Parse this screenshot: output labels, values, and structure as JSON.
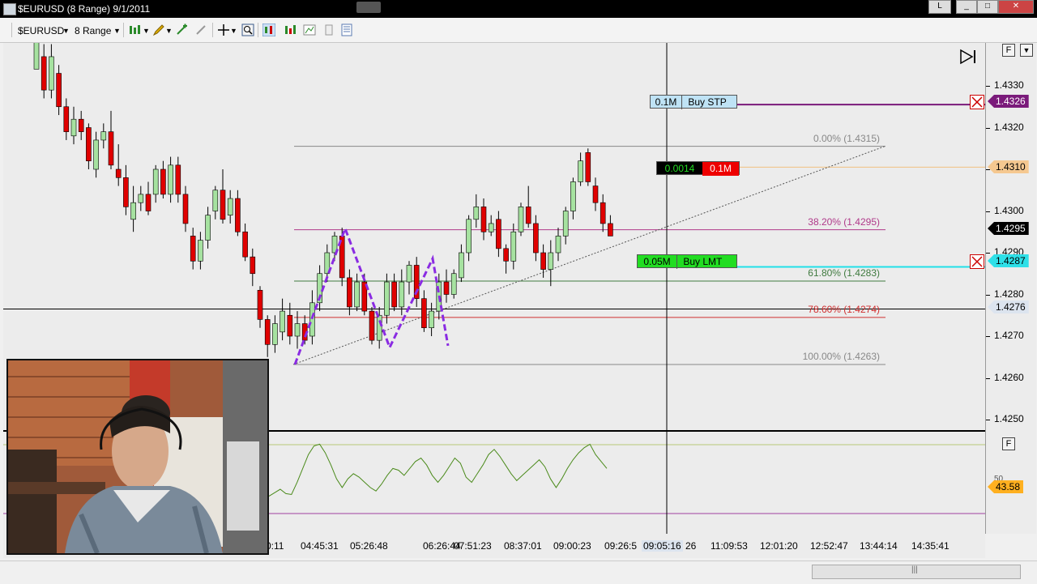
{
  "window": {
    "title": "$EURUSD (8 Range)  9/1/2011",
    "minimize": "_",
    "maximize": "□",
    "close": "✕",
    "extra_btn": "L"
  },
  "toolbar": {
    "instrument": "$EURUSD",
    "period": "8 Range"
  },
  "price_axis": {
    "ticks": [
      "1.4330",
      "1.4320",
      "1.4310",
      "1.4300",
      "1.4290",
      "1.4280",
      "1.4270",
      "1.4260",
      "1.4250"
    ],
    "labels": {
      "buy_stop": "1.4326",
      "position": "1.4310",
      "last": "1.4295",
      "buy_limit": "1.4287",
      "crosshair": "1.4276",
      "indicator": "43.58"
    },
    "indicator_tick": "50"
  },
  "orders": {
    "buy_stop": {
      "qty": "0.1M",
      "label": "Buy STP"
    },
    "position": {
      "pnl": "0.0014",
      "qty": "0.1M"
    },
    "buy_limit": {
      "qty": "0.05M",
      "label": "Buy LMT"
    }
  },
  "fib_levels": [
    {
      "label": "0.00% (1.4315)",
      "price": 1.43155,
      "color": "#888888"
    },
    {
      "label": "38.20% (1.4295)",
      "price": 1.42955,
      "color": "#b03a8a"
    },
    {
      "label": "61.80% (1.4283)",
      "price": 1.42832,
      "color": "#3f7a3f"
    },
    {
      "label": "78.60% (1.4274)",
      "price": 1.42745,
      "color": "#d03030"
    },
    {
      "label": "100.00% (1.4263)",
      "price": 1.42632,
      "color": "#888888"
    }
  ],
  "panel_buttons": {
    "f_top": "F",
    "f_bottom": "F",
    "dropdown": "▼"
  },
  "time_axis": {
    "labels": [
      "0:11",
      "04:45:31",
      "05:26:48",
      "06:26:44",
      "07:51:23",
      "08:37:01",
      "09:00:23",
      "09:26:5",
      "09:05:16",
      "26",
      "11:09:53",
      "12:01:20",
      "12:52:47",
      "13:44:14",
      "14:35:41"
    ],
    "left_stub": "2"
  },
  "chart_data": {
    "type": "candlestick",
    "instrument": "$EURUSD",
    "bar_type": "8 Range",
    "date": "9/1/2011",
    "ylim": [
      1.4245,
      1.434
    ],
    "candles": [
      {
        "o": 1.4334,
        "c": 1.4343,
        "h": 1.4348,
        "l": 1.4334
      },
      {
        "o": 1.4337,
        "c": 1.4329,
        "h": 1.434,
        "l": 1.4327
      },
      {
        "o": 1.4329,
        "c": 1.4337,
        "h": 1.434,
        "l": 1.4327
      },
      {
        "o": 1.4333,
        "c": 1.4325,
        "h": 1.4335,
        "l": 1.4323
      },
      {
        "o": 1.4325,
        "c": 1.4319,
        "h": 1.4327,
        "l": 1.4317
      },
      {
        "o": 1.4318,
        "c": 1.4322,
        "h": 1.4325,
        "l": 1.4316
      },
      {
        "o": 1.4322,
        "c": 1.4319,
        "h": 1.4324,
        "l": 1.4317
      },
      {
        "o": 1.432,
        "c": 1.4312,
        "h": 1.4321,
        "l": 1.431
      },
      {
        "o": 1.431,
        "c": 1.4317,
        "h": 1.4319,
        "l": 1.4308
      },
      {
        "o": 1.4317,
        "c": 1.4319,
        "h": 1.4321,
        "l": 1.4315
      },
      {
        "o": 1.4319,
        "c": 1.4311,
        "h": 1.4324,
        "l": 1.431
      },
      {
        "o": 1.431,
        "c": 1.4308,
        "h": 1.4316,
        "l": 1.4306
      },
      {
        "o": 1.4308,
        "c": 1.4301,
        "h": 1.4311,
        "l": 1.4299
      },
      {
        "o": 1.4298,
        "c": 1.4302,
        "h": 1.4306,
        "l": 1.4295
      },
      {
        "o": 1.4302,
        "c": 1.4304,
        "h": 1.4306,
        "l": 1.43
      },
      {
        "o": 1.4304,
        "c": 1.43,
        "h": 1.4307,
        "l": 1.4299
      },
      {
        "o": 1.4304,
        "c": 1.431,
        "h": 1.4311,
        "l": 1.4302
      },
      {
        "o": 1.431,
        "c": 1.4304,
        "h": 1.4312,
        "l": 1.4303
      },
      {
        "o": 1.4304,
        "c": 1.4311,
        "h": 1.4313,
        "l": 1.4302
      },
      {
        "o": 1.4311,
        "c": 1.4304,
        "h": 1.4313,
        "l": 1.4302
      },
      {
        "o": 1.4304,
        "c": 1.4297,
        "h": 1.4306,
        "l": 1.4295
      },
      {
        "o": 1.4294,
        "c": 1.4288,
        "h": 1.4296,
        "l": 1.4286
      },
      {
        "o": 1.4288,
        "c": 1.4293,
        "h": 1.4295,
        "l": 1.4286
      },
      {
        "o": 1.4293,
        "c": 1.4299,
        "h": 1.4301,
        "l": 1.4291
      },
      {
        "o": 1.43,
        "c": 1.4305,
        "h": 1.4306,
        "l": 1.4298
      },
      {
        "o": 1.4305,
        "c": 1.4298,
        "h": 1.431,
        "l": 1.4297
      },
      {
        "o": 1.4299,
        "c": 1.4303,
        "h": 1.4305,
        "l": 1.4297
      },
      {
        "o": 1.4303,
        "c": 1.4295,
        "h": 1.4305,
        "l": 1.4294
      },
      {
        "o": 1.4295,
        "c": 1.4289,
        "h": 1.4297,
        "l": 1.4288
      },
      {
        "o": 1.4289,
        "c": 1.4285,
        "h": 1.4291,
        "l": 1.4282
      },
      {
        "o": 1.4281,
        "c": 1.4274,
        "h": 1.4282,
        "l": 1.4272
      },
      {
        "o": 1.4274,
        "c": 1.4268,
        "h": 1.4275,
        "l": 1.4265
      },
      {
        "o": 1.4268,
        "c": 1.4273,
        "h": 1.4275,
        "l": 1.4266
      },
      {
        "o": 1.4271,
        "c": 1.4276,
        "h": 1.4279,
        "l": 1.4269
      },
      {
        "o": 1.4275,
        "c": 1.427,
        "h": 1.4278,
        "l": 1.4268
      },
      {
        "o": 1.427,
        "c": 1.4273,
        "h": 1.4276,
        "l": 1.4267
      },
      {
        "o": 1.4273,
        "c": 1.4269,
        "h": 1.4275,
        "l": 1.4268
      },
      {
        "o": 1.427,
        "c": 1.4278,
        "h": 1.4281,
        "l": 1.4268
      },
      {
        "o": 1.4278,
        "c": 1.4285,
        "h": 1.4287,
        "l": 1.4276
      },
      {
        "o": 1.4285,
        "c": 1.429,
        "h": 1.4292,
        "l": 1.4283
      },
      {
        "o": 1.429,
        "c": 1.4294,
        "h": 1.4295,
        "l": 1.4288
      },
      {
        "o": 1.4294,
        "c": 1.4284,
        "h": 1.4296,
        "l": 1.4282
      },
      {
        "o": 1.4284,
        "c": 1.4277,
        "h": 1.4286,
        "l": 1.4275
      },
      {
        "o": 1.4277,
        "c": 1.4283,
        "h": 1.4285,
        "l": 1.4276
      },
      {
        "o": 1.4283,
        "c": 1.4276,
        "h": 1.4285,
        "l": 1.4275
      },
      {
        "o": 1.4276,
        "c": 1.4269,
        "h": 1.4277,
        "l": 1.4268
      },
      {
        "o": 1.4269,
        "c": 1.4275,
        "h": 1.4277,
        "l": 1.4267
      },
      {
        "o": 1.4275,
        "c": 1.4283,
        "h": 1.4285,
        "l": 1.4273
      },
      {
        "o": 1.4283,
        "c": 1.4277,
        "h": 1.4285,
        "l": 1.4276
      },
      {
        "o": 1.4277,
        "c": 1.4283,
        "h": 1.4286,
        "l": 1.4275
      },
      {
        "o": 1.4283,
        "c": 1.4287,
        "h": 1.4288,
        "l": 1.428
      },
      {
        "o": 1.4287,
        "c": 1.4279,
        "h": 1.4289,
        "l": 1.4277
      },
      {
        "o": 1.4279,
        "c": 1.4272,
        "h": 1.4281,
        "l": 1.4271
      },
      {
        "o": 1.4272,
        "c": 1.4276,
        "h": 1.4278,
        "l": 1.427
      },
      {
        "o": 1.4276,
        "c": 1.4283,
        "h": 1.4285,
        "l": 1.4274
      },
      {
        "o": 1.4283,
        "c": 1.428,
        "h": 1.4286,
        "l": 1.4278
      },
      {
        "o": 1.428,
        "c": 1.4285,
        "h": 1.4286,
        "l": 1.4279
      },
      {
        "o": 1.4284,
        "c": 1.429,
        "h": 1.4292,
        "l": 1.4283
      },
      {
        "o": 1.429,
        "c": 1.4298,
        "h": 1.4299,
        "l": 1.4288
      },
      {
        "o": 1.4298,
        "c": 1.4301,
        "h": 1.4304,
        "l": 1.4296
      },
      {
        "o": 1.4301,
        "c": 1.4295,
        "h": 1.4303,
        "l": 1.4293
      },
      {
        "o": 1.4295,
        "c": 1.4297,
        "h": 1.4299,
        "l": 1.4294
      },
      {
        "o": 1.4298,
        "c": 1.4291,
        "h": 1.43,
        "l": 1.4289
      },
      {
        "o": 1.4291,
        "c": 1.4288,
        "h": 1.4292,
        "l": 1.4285
      },
      {
        "o": 1.4288,
        "c": 1.4295,
        "h": 1.4297,
        "l": 1.4286
      },
      {
        "o": 1.4295,
        "c": 1.4301,
        "h": 1.4302,
        "l": 1.4294
      },
      {
        "o": 1.4301,
        "c": 1.4297,
        "h": 1.4306,
        "l": 1.4296
      },
      {
        "o": 1.4297,
        "c": 1.429,
        "h": 1.4299,
        "l": 1.4288
      },
      {
        "o": 1.429,
        "c": 1.4286,
        "h": 1.4292,
        "l": 1.4284
      },
      {
        "o": 1.4286,
        "c": 1.429,
        "h": 1.4293,
        "l": 1.4282
      },
      {
        "o": 1.429,
        "c": 1.4294,
        "h": 1.4296,
        "l": 1.4288
      },
      {
        "o": 1.4294,
        "c": 1.43,
        "h": 1.4301,
        "l": 1.4292
      },
      {
        "o": 1.43,
        "c": 1.4307,
        "h": 1.4308,
        "l": 1.4298
      },
      {
        "o": 1.4307,
        "c": 1.4312,
        "h": 1.4314,
        "l": 1.4306
      },
      {
        "o": 1.4314,
        "c": 1.4307,
        "h": 1.4315,
        "l": 1.4306
      },
      {
        "o": 1.4306,
        "c": 1.4302,
        "h": 1.4308,
        "l": 1.43
      },
      {
        "o": 1.4302,
        "c": 1.4297,
        "h": 1.4304,
        "l": 1.4295
      },
      {
        "o": 1.4297,
        "c": 1.4294,
        "h": 1.4299,
        "l": 1.4294
      }
    ],
    "indicator": {
      "values": [
        20,
        24,
        28,
        23,
        22,
        36,
        52,
        68,
        78,
        80,
        70,
        56,
        40,
        30,
        40,
        46,
        42,
        36,
        30,
        26,
        34,
        44,
        52,
        50,
        44,
        52,
        60,
        64,
        56,
        44,
        36,
        44,
        54,
        64,
        58,
        42,
        36,
        46,
        56,
        68,
        74,
        66,
        56,
        46,
        38,
        44,
        50,
        56,
        62,
        54,
        40,
        30,
        40,
        52,
        62,
        70,
        76,
        80,
        68,
        60,
        52
      ],
      "last": 43.58
    }
  }
}
